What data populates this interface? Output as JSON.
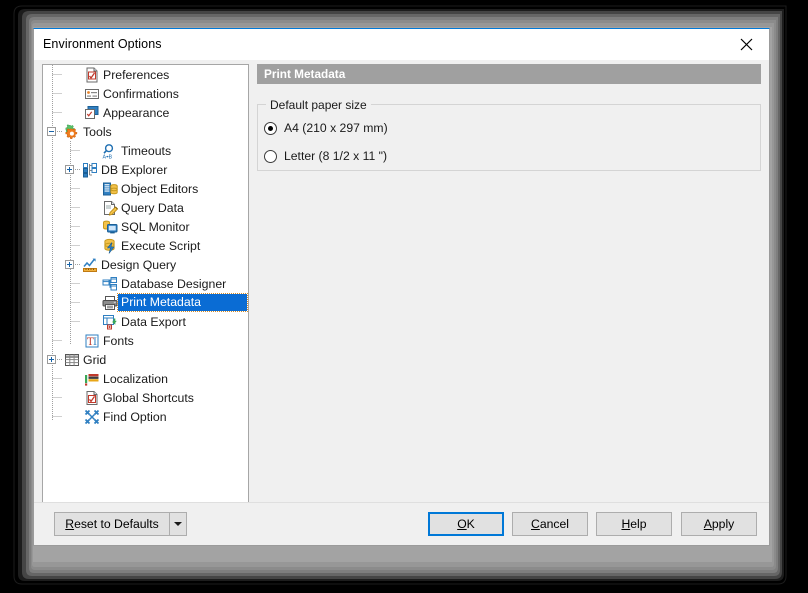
{
  "window": {
    "title": "Environment Options",
    "close_icon": "close-icon"
  },
  "tree": {
    "items": [
      {
        "label": "Preferences",
        "level": 1,
        "icon": "preferences-icon",
        "expander": "none",
        "selected": false
      },
      {
        "label": "Confirmations",
        "level": 1,
        "icon": "confirmations-icon",
        "expander": "none",
        "selected": false
      },
      {
        "label": "Appearance",
        "level": 1,
        "icon": "appearance-icon",
        "expander": "none",
        "selected": false
      },
      {
        "label": "Tools",
        "level": 0,
        "icon": "tools-icon",
        "expander": "minus",
        "selected": false
      },
      {
        "label": "Timeouts",
        "level": 2,
        "icon": "timeouts-icon",
        "expander": "none",
        "selected": false
      },
      {
        "label": "DB Explorer",
        "level": 1,
        "icon": "db-explorer-icon",
        "expander": "plus",
        "selected": false
      },
      {
        "label": "Object Editors",
        "level": 2,
        "icon": "object-editors-icon",
        "expander": "none",
        "selected": false
      },
      {
        "label": "Query Data",
        "level": 2,
        "icon": "query-data-icon",
        "expander": "none",
        "selected": false
      },
      {
        "label": "SQL Monitor",
        "level": 2,
        "icon": "sql-monitor-icon",
        "expander": "none",
        "selected": false
      },
      {
        "label": "Execute Script",
        "level": 2,
        "icon": "execute-script-icon",
        "expander": "none",
        "selected": false
      },
      {
        "label": "Design Query",
        "level": 1,
        "icon": "design-query-icon",
        "expander": "plus",
        "selected": false
      },
      {
        "label": "Database Designer",
        "level": 2,
        "icon": "database-designer-icon",
        "expander": "none",
        "selected": false
      },
      {
        "label": "Print Metadata",
        "level": 2,
        "icon": "print-metadata-icon",
        "expander": "none",
        "selected": true
      },
      {
        "label": "Data Export",
        "level": 2,
        "icon": "data-export-icon",
        "expander": "none",
        "selected": false
      },
      {
        "label": "Fonts",
        "level": 1,
        "icon": "fonts-icon",
        "expander": "none",
        "selected": false
      },
      {
        "label": "Grid",
        "level": 0,
        "icon": "grid-icon",
        "expander": "plus",
        "selected": false
      },
      {
        "label": "Localization",
        "level": 1,
        "icon": "localization-icon",
        "expander": "none",
        "selected": false
      },
      {
        "label": "Global Shortcuts",
        "level": 1,
        "icon": "global-shortcuts-icon",
        "expander": "none",
        "selected": false
      },
      {
        "label": "Find Option",
        "level": 1,
        "icon": "find-option-icon",
        "expander": "none",
        "selected": false
      }
    ]
  },
  "content": {
    "page_title": "Print Metadata",
    "group_title": "Default paper size",
    "options": [
      {
        "label": "A4 (210 x 297 mm)",
        "checked": true
      },
      {
        "label": "Letter (8 1/2 x 11 \")",
        "checked": false
      }
    ]
  },
  "footer": {
    "reset_prefix": "",
    "reset_acc": "R",
    "reset_suffix": "eset to Defaults",
    "ok_prefix": "",
    "ok_acc": "O",
    "ok_suffix": "K",
    "cancel_prefix": "",
    "cancel_acc": "C",
    "cancel_suffix": "ancel",
    "help_prefix": "",
    "help_acc": "H",
    "help_suffix": "elp",
    "apply_prefix": "",
    "apply_acc": "A",
    "apply_suffix": "pply",
    "dropdown_icon": "chevron-down-icon"
  },
  "colors": {
    "accent": "#0078d7",
    "selection": "#0a6cd4",
    "header_bar": "#a0a0a0",
    "dialog_bg": "#f0f0f0"
  }
}
